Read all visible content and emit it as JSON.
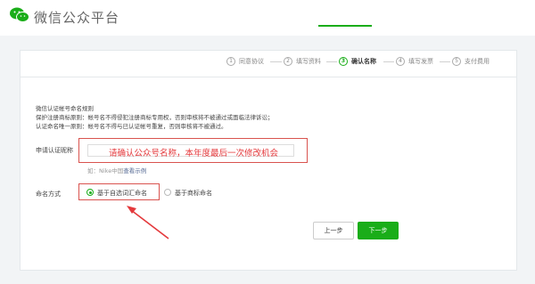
{
  "header": {
    "brand": "微信公众平台",
    "logo_icon": "wechat-logo-icon",
    "accent": "#1aad19"
  },
  "steps": [
    {
      "num": "1",
      "label": "同意协议",
      "active": false
    },
    {
      "num": "2",
      "label": "填写资料",
      "active": false
    },
    {
      "num": "3",
      "label": "确认名称",
      "active": true
    },
    {
      "num": "4",
      "label": "填写发票",
      "active": false
    },
    {
      "num": "5",
      "label": "支付费用",
      "active": false
    }
  ],
  "rules": {
    "title": "微信认证帐号命名规则",
    "lines": [
      "保护注册商标原则：帐号名不得侵犯注册商标专用权，否则审核将不被通过或面临法律诉讼；",
      "认证命名唯一原则：帐号名不得与已认证帐号重复，否则审核将不被通过。"
    ]
  },
  "form": {
    "apply_label": "申请认证昵称",
    "name_value": "",
    "callout": "请确认公众号名称，本年度最后一次修改机会",
    "example_prefix": "如：Nike中国",
    "example_link": "查看示例",
    "naming_label": "命名方式",
    "options": [
      {
        "label": "基于自选词汇命名",
        "checked": true
      },
      {
        "label": "基于商标命名",
        "checked": false
      }
    ]
  },
  "buttons": {
    "prev": "上一步",
    "next": "下一步"
  },
  "colors": {
    "highlight": "#d9534f",
    "callout_text": "#e4393c"
  }
}
